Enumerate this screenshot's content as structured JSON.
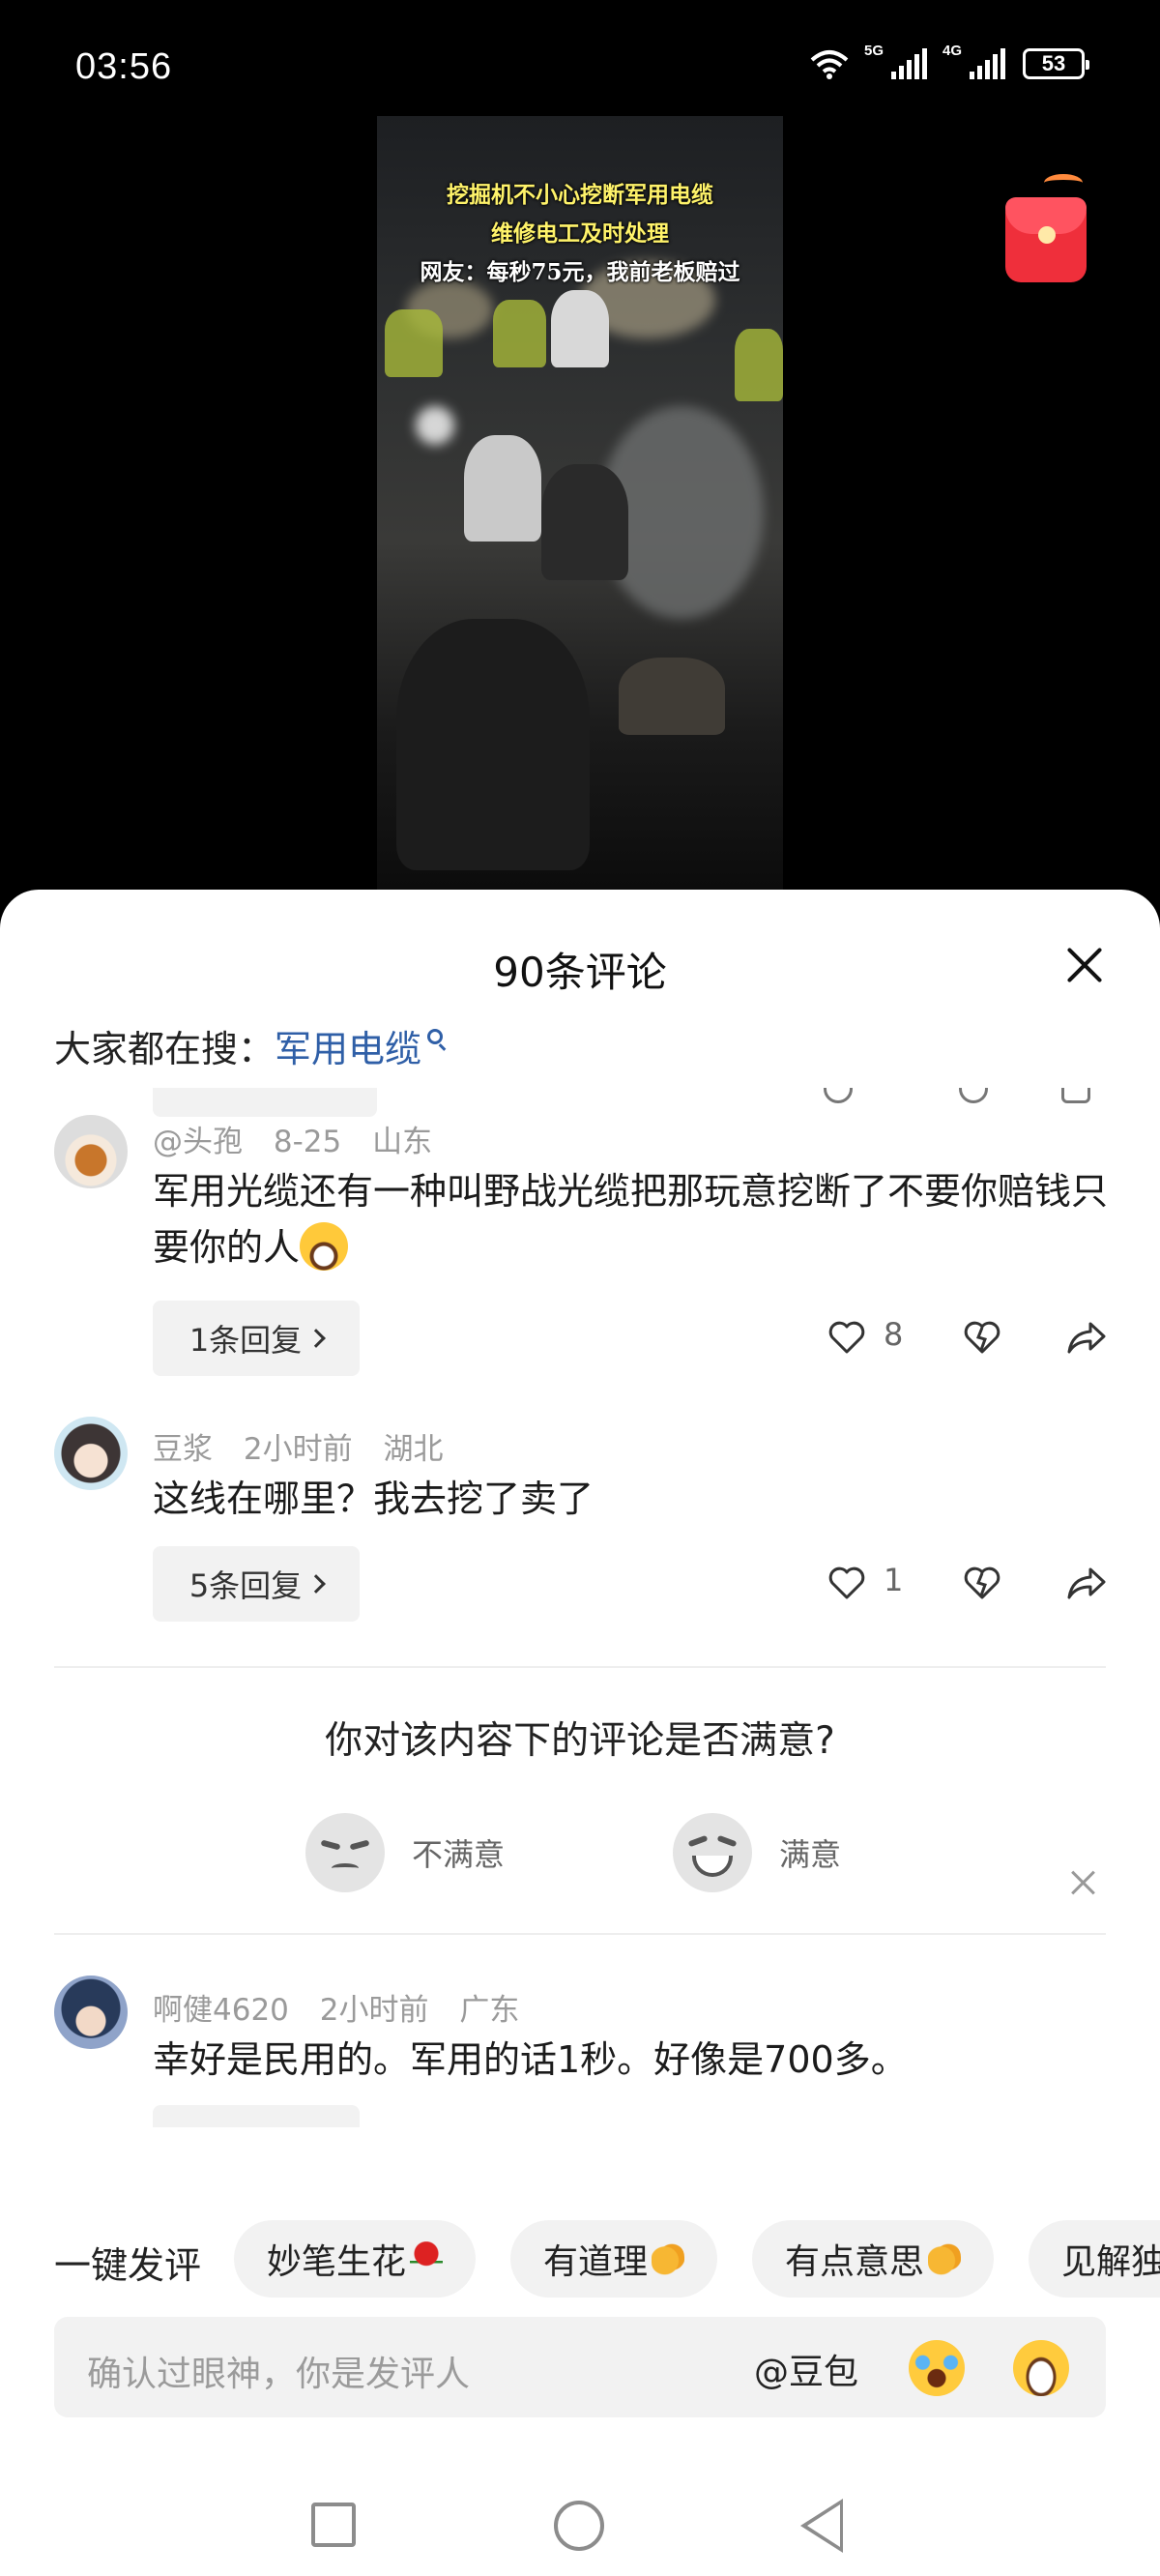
{
  "status_bar": {
    "time": "03:56",
    "network_1": "5G",
    "network_2": "4G",
    "battery": "53"
  },
  "video": {
    "caption_line1": "挖掘机不小心挖断军用电缆",
    "caption_line2": "维修电工及时处理",
    "caption_line3": "网友：每秒75元，我前老板赔过"
  },
  "sheet": {
    "title": "90条评论",
    "search_prefix": "大家都在搜：",
    "search_keyword": "军用电缆"
  },
  "comments": [
    {
      "user": "@头孢",
      "time": "8-25",
      "location": "山东",
      "text": "军用光缆还有一种叫野战光缆把那玩意挖断了不要你赔钱只要你的人",
      "reply_label": "1条回复",
      "likes": "8"
    },
    {
      "user": "豆浆",
      "time": "2小时前",
      "location": "湖北",
      "text": "这线在哪里？我去挖了卖了",
      "reply_label": "5条回复",
      "likes": "1"
    },
    {
      "user": "啊健4620",
      "time": "2小时前",
      "location": "广东",
      "text": "幸好是民用的。军用的话1秒。好像是700多。"
    }
  ],
  "survey": {
    "question": "你对该内容下的评论是否满意?",
    "option_unsatisfied": "不满意",
    "option_satisfied": "满意"
  },
  "quick_comments": {
    "label": "一键发评",
    "chips": [
      "妙笔生花",
      "有道理",
      "有点意思",
      "见解独"
    ]
  },
  "input": {
    "placeholder": "确认过眼神，你是发评人",
    "mention": "@豆包"
  },
  "colors": {
    "accent_link": "#2f5fa7",
    "caption_yellow": "#fff36a",
    "red_packet": "#ef2f3b"
  }
}
